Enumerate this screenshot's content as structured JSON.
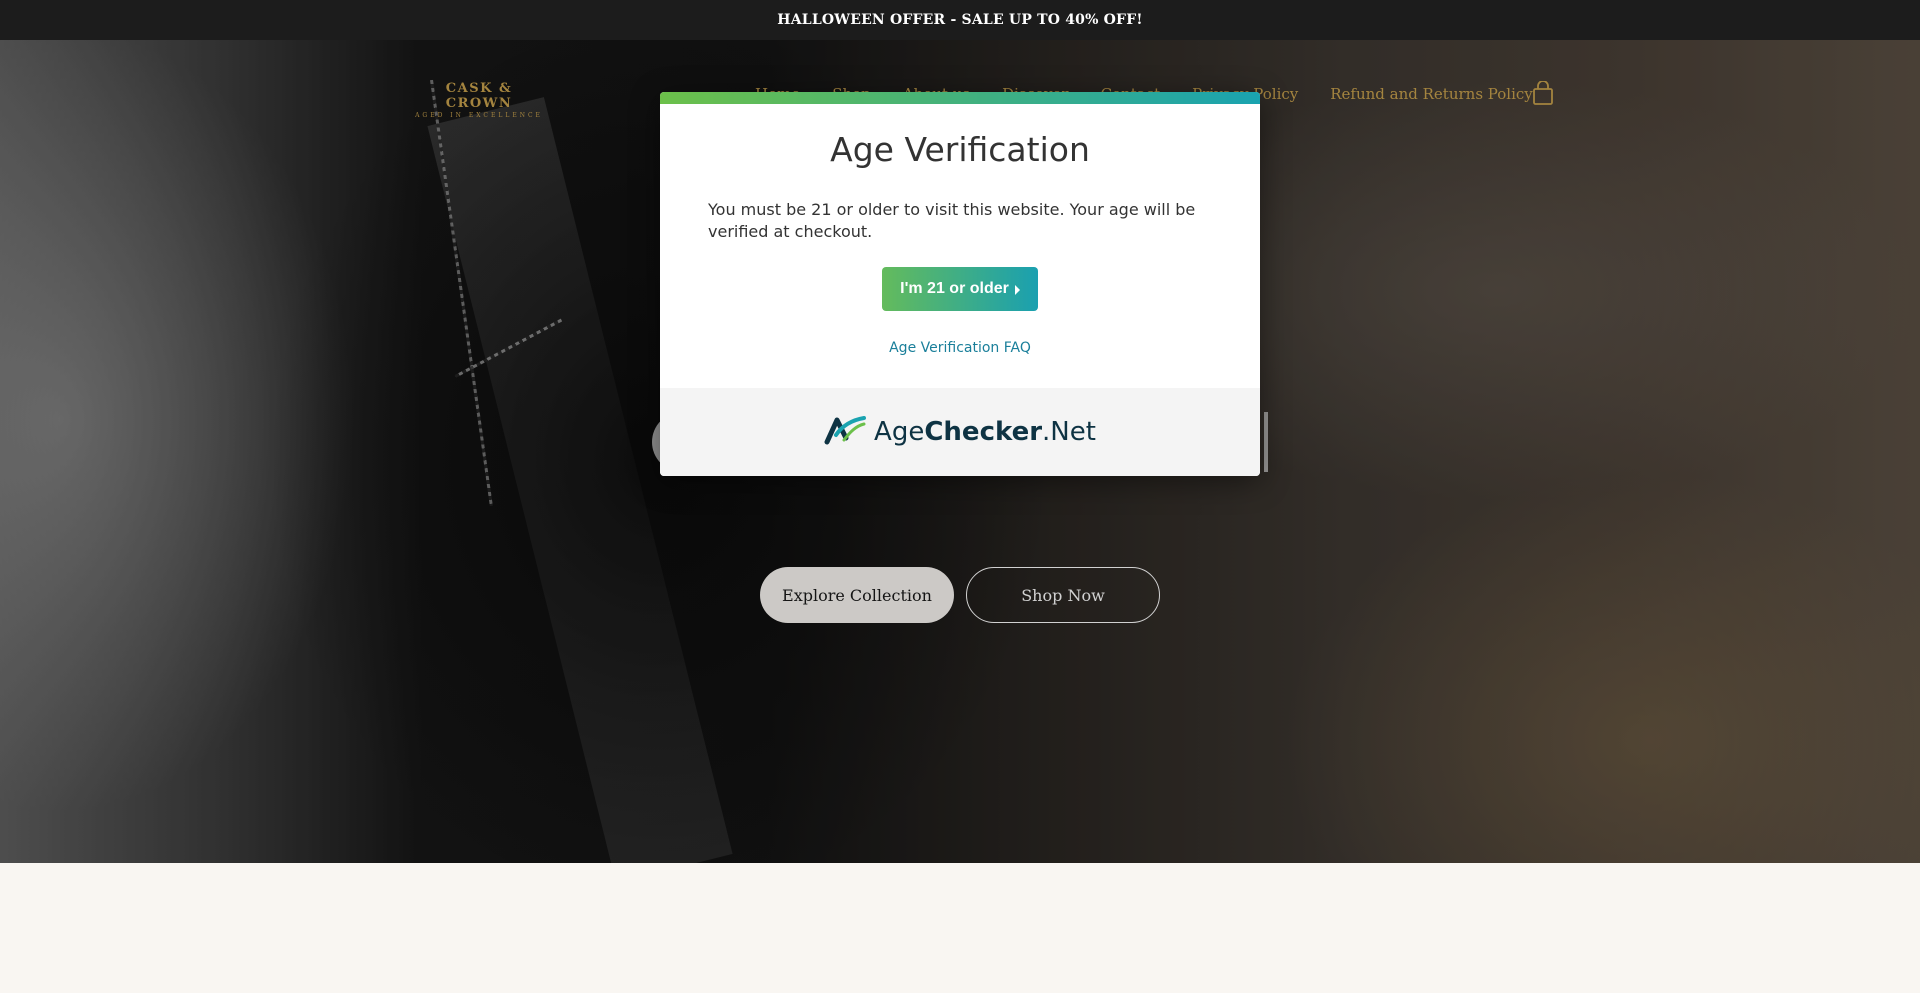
{
  "announcement": {
    "text": "HALLOWEEN OFFER - SALE UP TO 40% OFF!"
  },
  "header": {
    "logo_main": "CASK & CROWN",
    "logo_sub": "AGED IN EXCELLENCE",
    "nav": [
      {
        "label": "Home"
      },
      {
        "label": "Shop"
      },
      {
        "label": "About us"
      },
      {
        "label": "Discover"
      },
      {
        "label": "Contact"
      },
      {
        "label": "Privacy Policy"
      },
      {
        "label": "Refund and Returns Policy"
      }
    ],
    "cart_icon": "shopping-bag-icon",
    "accent_color": "#c9a24d"
  },
  "hero": {
    "explore_label": "Explore Collection",
    "shop_label": "Shop Now"
  },
  "modal": {
    "title": "Age Verification",
    "message": "You must be 21 or older to visit this website. Your age will be verified at checkout.",
    "confirm_label": "I'm 21 or older",
    "faq_label": "Age Verification FAQ",
    "brand_prefix": "Age",
    "brand_strong": "Checker",
    "brand_suffix": ".Net",
    "gradient_start": "#6cc04a",
    "gradient_end": "#1aa3b0"
  }
}
